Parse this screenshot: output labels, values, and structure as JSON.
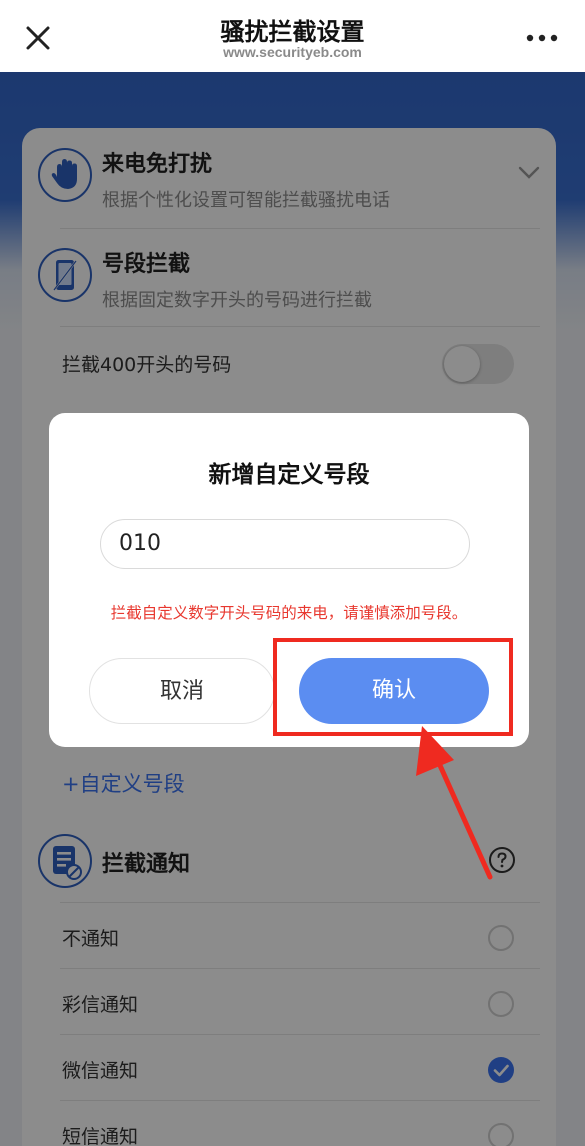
{
  "header": {
    "title": "骚扰拦截设置",
    "watermark_url": "www.securityeb.com",
    "close_icon": "close-icon",
    "more_icon": "more-dots-icon"
  },
  "card": {
    "call_dnd": {
      "title": "来电免打扰",
      "desc": "根据个性化设置可智能拦截骚扰电话",
      "icon": "hand-stop-icon"
    },
    "number_block": {
      "title": "号段拦截",
      "desc": "根据固定数字开头的号码进行拦截",
      "icon": "phone-slash-icon"
    },
    "block_400_label": "拦截400开头的号码",
    "add_custom_label": "+自定义号段",
    "notify": {
      "title": "拦截通知",
      "icon": "notice-doc-icon",
      "help_icon": "question-icon"
    },
    "notify_options": [
      {
        "label": "不通知",
        "checked": false
      },
      {
        "label": "彩信通知",
        "checked": false
      },
      {
        "label": "微信通知",
        "checked": true
      },
      {
        "label": "短信通知",
        "checked": false
      }
    ]
  },
  "dialog": {
    "title": "新增自定义号段",
    "input_value": "010",
    "warning": "拦截自定义数字开头号码的来电，请谨慎添加号段。",
    "cancel_label": "取消",
    "confirm_label": "确认"
  },
  "colors": {
    "accent": "#3b74f0",
    "confirm_button": "#5b8df1",
    "warning": "#e8382f",
    "annotation": "#ef2a20"
  }
}
